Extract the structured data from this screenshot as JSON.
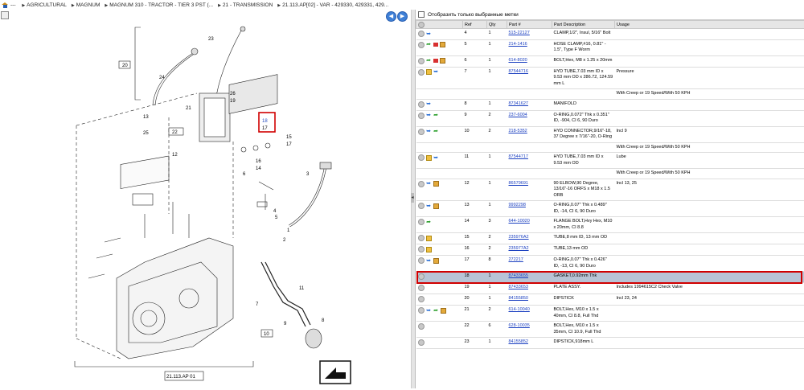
{
  "breadcrumb": [
    "--- ",
    "AGRICULTURAL",
    "MAGNUM",
    "MAGNUM 310 - TRACTOR - TIER 3 PST (...",
    "21 - TRANSMISSION",
    "21.113.AP[02] - VAR - 429330, 429331, 429..."
  ],
  "filter_label": "Отобразить только выбранные метки",
  "columns": [
    "",
    "Ref",
    "Qty",
    "Part #",
    "Part Description",
    "Usage"
  ],
  "diagram": {
    "labels": [
      "20",
      "23",
      "24",
      "13",
      "22",
      "12",
      "25",
      "21",
      "26",
      "19",
      "18",
      "17",
      "15",
      "16",
      "14",
      "6",
      "3",
      "1",
      "2",
      "5",
      "7",
      "11",
      "9",
      "10",
      "8",
      "4"
    ],
    "box_ref": "21.113.AP 01"
  },
  "rows": [
    {
      "icons": [
        "cart",
        "arrow"
      ],
      "ref": "4",
      "qty": "1",
      "part": "515-22127",
      "desc": "CLAMP,1/2\", Insul, 5/16\" Bolt",
      "usage": ""
    },
    {
      "icons": [
        "cart",
        "green",
        "red",
        "box"
      ],
      "ref": "5",
      "qty": "1",
      "part": "214-1416",
      "desc": "HOSE CLAMP,#16, 0.81\" - 1.5\", Type F Worm",
      "usage": ""
    },
    {
      "icons": [
        "cart",
        "green",
        "red",
        "box"
      ],
      "ref": "6",
      "qty": "1",
      "part": "614-8020",
      "desc": "BOLT,Hex, M8 x 1.25 x 20mm",
      "usage": ""
    },
    {
      "icons": [
        "cart",
        "note",
        "arrow"
      ],
      "ref": "7",
      "qty": "1",
      "part": "87544716",
      "desc": "HYD TUBE,7.03 mm ID x 9.53 mm OD x 286.72, 124.59 mm L",
      "usage": "Pressure"
    },
    {
      "extra": "With Creep or 19 Speed/With 50 KPH"
    },
    {
      "icons": [
        "cart",
        "arrow"
      ],
      "ref": "8",
      "qty": "1",
      "part": "87341627",
      "desc": "MANIFOLD",
      "usage": ""
    },
    {
      "icons": [
        "cart",
        "arrow",
        "green"
      ],
      "ref": "9",
      "qty": "2",
      "part": "237-6004",
      "desc": "O-RING,0.072\" Thk x 0.351\" ID, -904, CI 6, 90 Duro",
      "usage": ""
    },
    {
      "icons": [
        "cart",
        "arrow",
        "green"
      ],
      "ref": "10",
      "qty": "2",
      "part": "218-5352",
      "desc": "HYD CONNECTOR,9/16\"-18, 37 Degree x 7/16\"-20, O-Ring",
      "usage": "Incl 9"
    },
    {
      "extra": "With Creep or 19 Speed/With 50 KPH"
    },
    {
      "icons": [
        "cart",
        "note",
        "arrow"
      ],
      "ref": "11",
      "qty": "1",
      "part": "87544717",
      "desc": "HYD TUBE,7.03 mm ID x 9.53 mm OD",
      "usage": "Lube"
    },
    {
      "extra": "With Creep or 19 Speed/With 50 KPH"
    },
    {
      "icons": [
        "cart",
        "arrow",
        "box"
      ],
      "ref": "12",
      "qty": "1",
      "part": "86579691",
      "desc": "90 ELBOW,90 Degree, 13/16\"-16 ORFS x M18 x 1.5 ORB",
      "usage": "Incl 13, 25"
    },
    {
      "icons": [
        "cart",
        "arrow",
        "box"
      ],
      "ref": "13",
      "qty": "1",
      "part": "9992298",
      "desc": "O-RING,0.07\" Thk x 0.489\" ID, -14, CI 6, 90 Duro",
      "usage": ""
    },
    {
      "icons": [
        "cart",
        "green"
      ],
      "ref": "14",
      "qty": "3",
      "part": "644-10020",
      "desc": "FLANGE BOLT,Hvy Hex, M10 x 20mm, CI 8.8",
      "usage": ""
    },
    {
      "icons": [
        "cart",
        "note"
      ],
      "ref": "15",
      "qty": "2",
      "part": "235976A2",
      "desc": "TUBE,8 mm ID, 13 mm OD",
      "usage": ""
    },
    {
      "icons": [
        "cart",
        "note"
      ],
      "ref": "16",
      "qty": "2",
      "part": "235977A2",
      "desc": "TUBE,13 mm OD",
      "usage": ""
    },
    {
      "icons": [
        "cart",
        "arrow",
        "box"
      ],
      "ref": "17",
      "qty": "8",
      "part": "272217",
      "desc": "O-RING,0.07\" Thk x 0.426\" ID, -13, CI 6, 90 Duro",
      "usage": ""
    },
    {
      "icons": [
        "cart"
      ],
      "ref": "18",
      "qty": "1",
      "part": "87433655",
      "desc": "GASKET,0.92mm Thk",
      "usage": "",
      "selected": true
    },
    {
      "icons": [
        "cart"
      ],
      "ref": "19",
      "qty": "1",
      "part": "87433653",
      "desc": "PLATE ASSY.",
      "usage": "Includes 1994615C2 Check Valve"
    },
    {
      "icons": [
        "cart"
      ],
      "ref": "20",
      "qty": "1",
      "part": "84155850",
      "desc": "DIPSTICK",
      "usage": "Incl 23, 24"
    },
    {
      "icons": [
        "cart",
        "arrow",
        "green",
        "box"
      ],
      "ref": "21",
      "qty": "2",
      "part": "614-10040",
      "desc": "BOLT,Hex, M10 x 1.5 x 40mm, CI 8.8, Full Thd",
      "usage": ""
    },
    {
      "icons": [
        "cart"
      ],
      "ref": "22",
      "qty": "6",
      "part": "628-10035",
      "desc": "BOLT,Hex, M10 x 1.5 x 35mm, CI 10.9, Full Thd",
      "usage": ""
    },
    {
      "icons": [
        "cart"
      ],
      "ref": "23",
      "qty": "1",
      "part": "84155852",
      "desc": "DIPSTICK,918mm L",
      "usage": ""
    }
  ]
}
